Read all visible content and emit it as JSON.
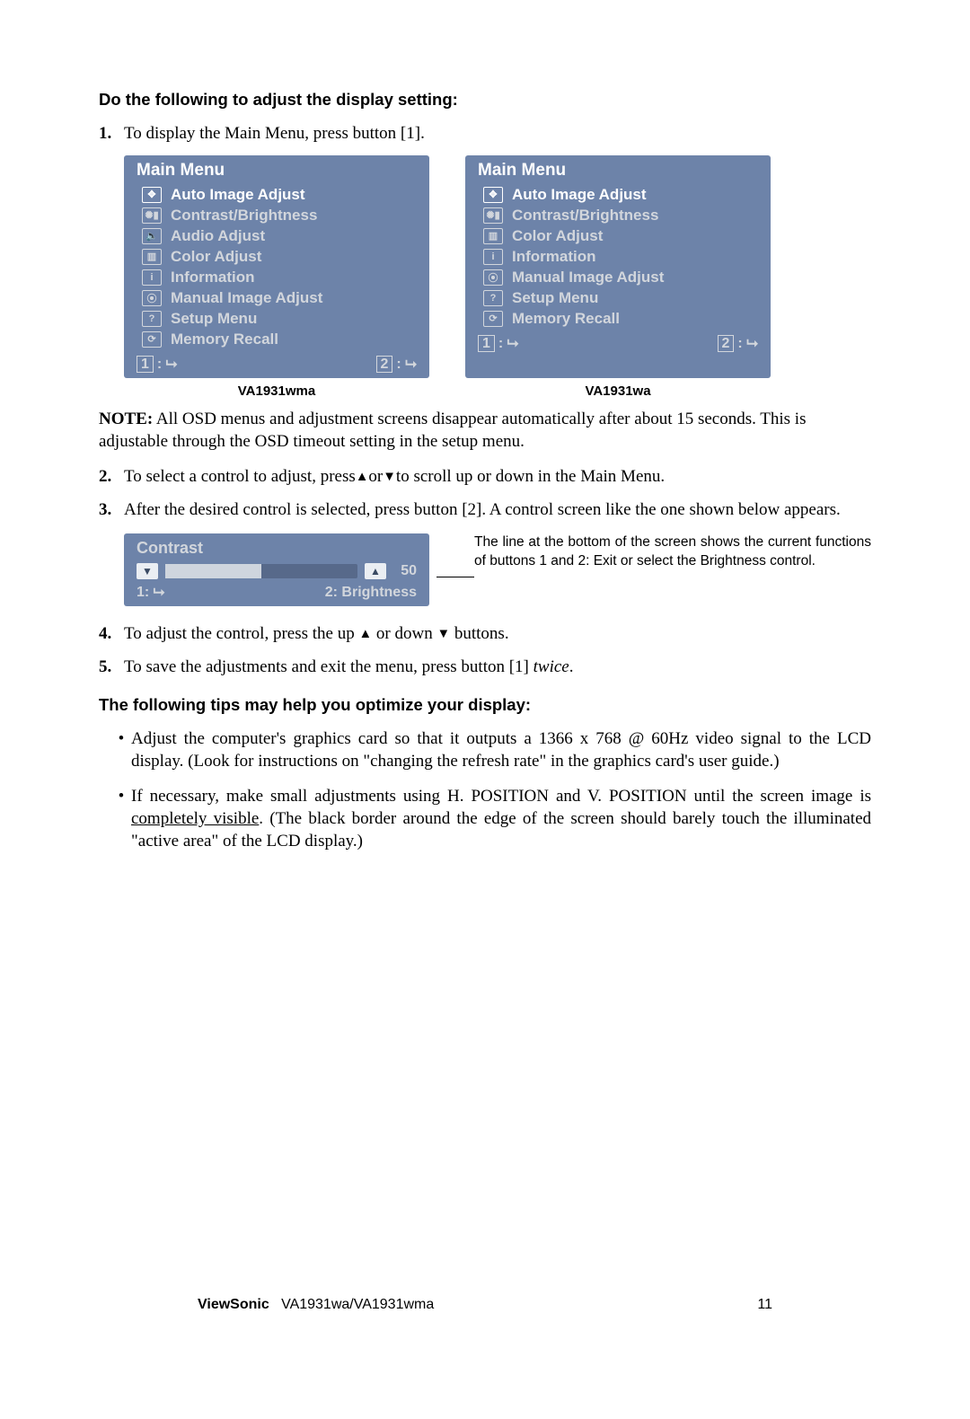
{
  "heading1": "Do the following to adjust the display setting:",
  "step1_num": "1.",
  "step1_text": "To display the Main Menu, press button [1].",
  "main_menu_title": "Main Menu",
  "menu_items_wma": [
    "Auto Image Adjust",
    "Contrast/Brightness",
    "Audio Adjust",
    "Color Adjust",
    "Information",
    "Manual Image Adjust",
    "Setup Menu",
    "Memory Recall"
  ],
  "menu_icons_wma": [
    "✥",
    "✺▮",
    "🔈",
    "▥",
    "i",
    "⦿",
    "?",
    "⟳"
  ],
  "menu_items_wa": [
    "Auto Image Adjust",
    "Contrast/Brightness",
    "Color Adjust",
    "Information",
    "Manual Image Adjust",
    "Setup Menu",
    "Memory Recall"
  ],
  "menu_icons_wa": [
    "✥",
    "✺▮",
    "▥",
    "i",
    "⦿",
    "?",
    "⟳"
  ],
  "footer_key1": "1",
  "footer_key2": "2",
  "footer_glyph": ": ⮡",
  "caption_wma": "VA1931wma",
  "caption_wa": "VA1931wa",
  "note_label": "NOTE:",
  "note_text": " All OSD menus and adjustment screens disappear automatically after about 15 seconds. This is adjustable through the OSD timeout setting in the setup menu.",
  "step2_num": "2.",
  "step2_text_a": "To select a control to adjust, press",
  "step2_tri_up": "▲",
  "step2_or": "or",
  "step2_tri_down": "▼",
  "step2_text_b": "to scroll up or down in the Main Menu.",
  "step3_num": "3.",
  "step3_text": "After the desired control is selected, press button [2]. A control screen like the one shown below appears.",
  "contrast_title": "Contrast",
  "contrast_value": "50",
  "contrast_foot_right_key": "2",
  "contrast_foot_right_label": ": Brightness",
  "contrast_note": "The line at the bottom of the screen shows the current functions of buttons 1 and 2: Exit or select the Brightness control.",
  "step4_num": "4.",
  "step4_text_a": "To adjust the control, press the up ",
  "step4_tri_up": "▲",
  "step4_text_mid": " or down ",
  "step4_tri_down": "▼",
  "step4_text_b": " buttons.",
  "step5_num": "5.",
  "step5_text_a": "To save the adjustments and exit the menu, press button [1] ",
  "step5_twice": "twice",
  "step5_text_b": ".",
  "heading2": "The following tips may help you optimize your display:",
  "tip1": "Adjust the computer's graphics card so that it outputs a 1366 x 768 @ 60Hz video signal to the LCD display. (Look for instructions on \"changing the refresh rate\" in the graphics card's user guide.)",
  "tip2_a": "If necessary, make small adjustments using H. POSITION and V. POSITION until the screen image is ",
  "tip2_underline": "completely visible",
  "tip2_b": ". (The black border around the edge of the screen should barely touch the illuminated \"active area\" of the LCD display.)",
  "footer_brand": "ViewSonic",
  "footer_model": "VA1931wa/VA1931wma",
  "footer_page": "11"
}
